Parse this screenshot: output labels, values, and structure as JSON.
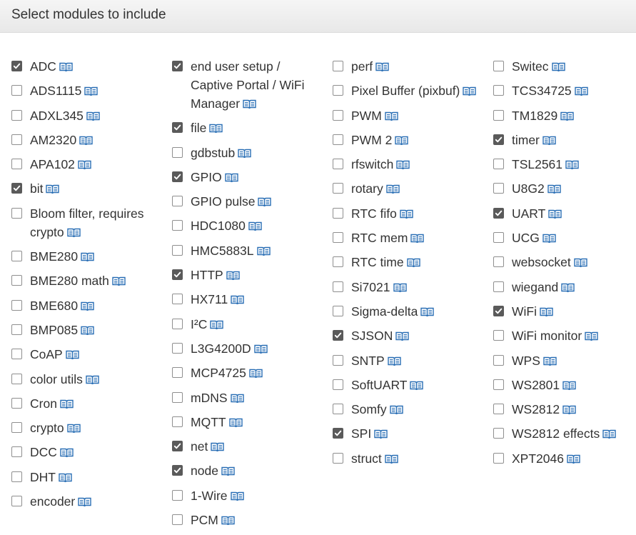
{
  "header": {
    "title": "Select modules to include"
  },
  "columns": [
    [
      {
        "label": "ADC",
        "checked": true
      },
      {
        "label": "ADS1115",
        "checked": false
      },
      {
        "label": "ADXL345",
        "checked": false
      },
      {
        "label": "AM2320",
        "checked": false
      },
      {
        "label": "APA102",
        "checked": false
      },
      {
        "label": "bit",
        "checked": true
      },
      {
        "label": "Bloom filter, requires crypto",
        "checked": false,
        "width": 190
      },
      {
        "label": "BME280",
        "checked": false
      },
      {
        "label": "BME280 math",
        "checked": false
      },
      {
        "label": "BME680",
        "checked": false
      },
      {
        "label": "BMP085",
        "checked": false
      },
      {
        "label": "CoAP",
        "checked": false
      },
      {
        "label": "color utils",
        "checked": false
      },
      {
        "label": "Cron",
        "checked": false
      },
      {
        "label": "crypto",
        "checked": false
      },
      {
        "label": "DCC",
        "checked": false
      },
      {
        "label": "DHT",
        "checked": false
      },
      {
        "label": "encoder",
        "checked": false
      }
    ],
    [
      {
        "label": "end user setup / Captive Portal / WiFi Manager",
        "checked": true,
        "width": 180
      },
      {
        "label": "file",
        "checked": true
      },
      {
        "label": "gdbstub",
        "checked": false
      },
      {
        "label": "GPIO",
        "checked": true
      },
      {
        "label": "GPIO pulse",
        "checked": false
      },
      {
        "label": "HDC1080",
        "checked": false
      },
      {
        "label": "HMC5883L",
        "checked": false
      },
      {
        "label": "HTTP",
        "checked": true
      },
      {
        "label": "HX711",
        "checked": false
      },
      {
        "label": "I²C",
        "checked": false
      },
      {
        "label": "L3G4200D",
        "checked": false
      },
      {
        "label": "MCP4725",
        "checked": false
      },
      {
        "label": "mDNS",
        "checked": false
      },
      {
        "label": "MQTT",
        "checked": false
      },
      {
        "label": "net",
        "checked": true
      },
      {
        "label": "node",
        "checked": true
      },
      {
        "label": "1-Wire",
        "checked": false
      },
      {
        "label": "PCM",
        "checked": false
      }
    ],
    [
      {
        "label": "perf",
        "checked": false
      },
      {
        "label": "Pixel Buffer (pixbuf)",
        "checked": false,
        "width": 185
      },
      {
        "label": "PWM",
        "checked": false
      },
      {
        "label": "PWM 2",
        "checked": false
      },
      {
        "label": "rfswitch",
        "checked": false
      },
      {
        "label": "rotary",
        "checked": false
      },
      {
        "label": "RTC fifo",
        "checked": false
      },
      {
        "label": "RTC mem",
        "checked": false
      },
      {
        "label": "RTC time",
        "checked": false
      },
      {
        "label": "Si7021",
        "checked": false
      },
      {
        "label": "Sigma-delta",
        "checked": false
      },
      {
        "label": "SJSON",
        "checked": true
      },
      {
        "label": "SNTP",
        "checked": false
      },
      {
        "label": "SoftUART",
        "checked": false
      },
      {
        "label": "Somfy",
        "checked": false
      },
      {
        "label": "SPI",
        "checked": true
      },
      {
        "label": "struct",
        "checked": false
      }
    ],
    [
      {
        "label": "Switec",
        "checked": false
      },
      {
        "label": "TCS34725",
        "checked": false
      },
      {
        "label": "TM1829",
        "checked": false
      },
      {
        "label": "timer",
        "checked": true
      },
      {
        "label": "TSL2561",
        "checked": false
      },
      {
        "label": "U8G2",
        "checked": false
      },
      {
        "label": "UART",
        "checked": true
      },
      {
        "label": "UCG",
        "checked": false
      },
      {
        "label": "websocket",
        "checked": false
      },
      {
        "label": "wiegand",
        "checked": false
      },
      {
        "label": "WiFi",
        "checked": true
      },
      {
        "label": "WiFi monitor",
        "checked": false
      },
      {
        "label": "WPS",
        "checked": false
      },
      {
        "label": "WS2801",
        "checked": false
      },
      {
        "label": "WS2812",
        "checked": false
      },
      {
        "label": "WS2812 effects",
        "checked": false
      },
      {
        "label": "XPT2046",
        "checked": false
      }
    ]
  ],
  "icons": {
    "doc_link": "book-icon"
  },
  "colors": {
    "link": "#2a6fb5",
    "checkbox_checked": "#5a5a5a"
  }
}
